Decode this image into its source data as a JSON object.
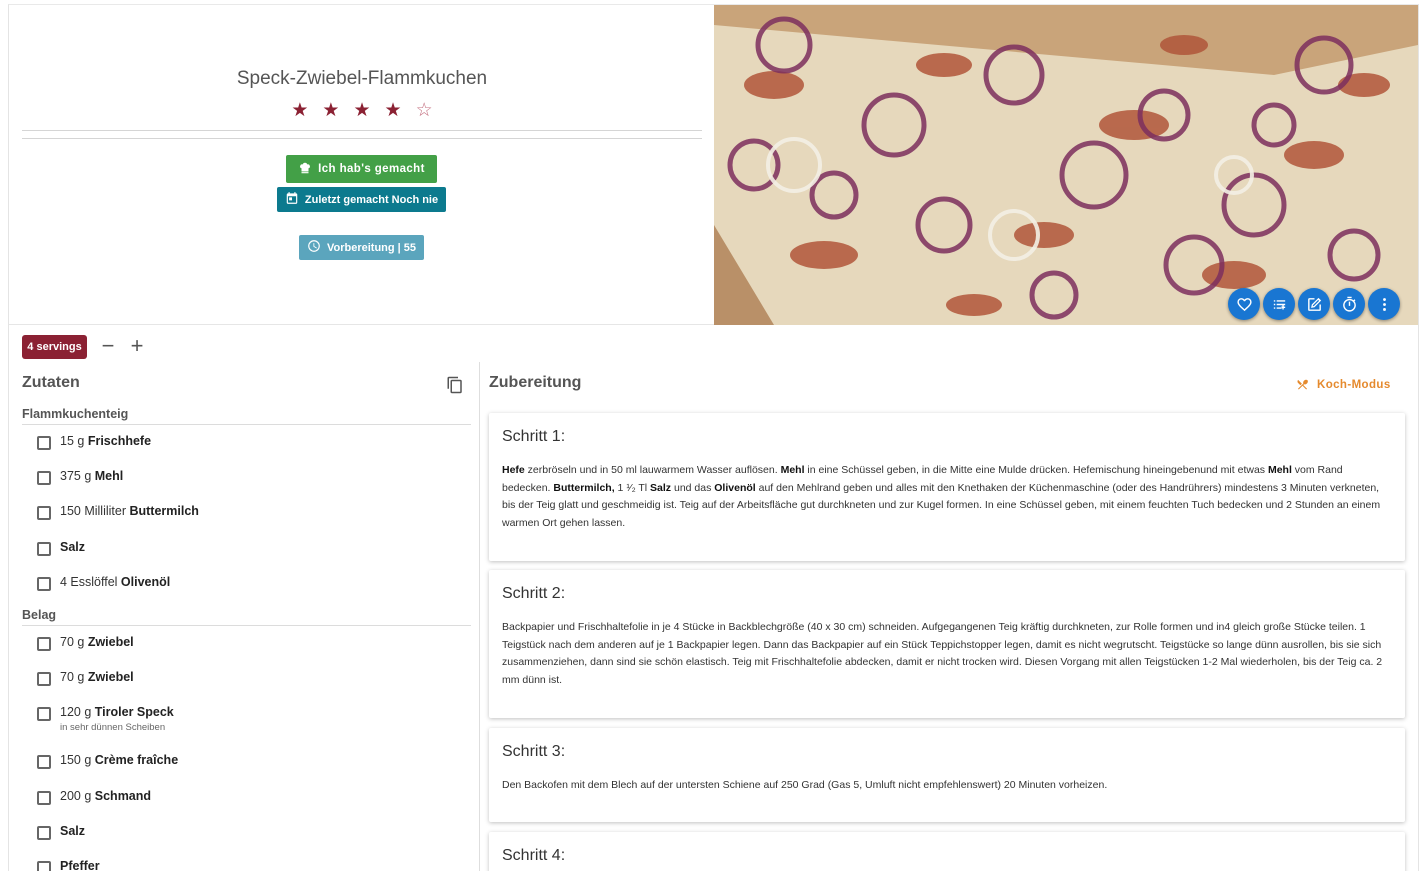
{
  "recipe": {
    "title": "Speck-Zwiebel-Flammkuchen",
    "rating": 4,
    "max_rating": 5,
    "made_button": "Ich hab's gemacht",
    "last_made": "Zuletzt gemacht Noch nie",
    "prep_time": "Vorbereitung | 55"
  },
  "servings": {
    "label": "4 servings",
    "minus": "−",
    "plus": "+"
  },
  "ingredients": {
    "title": "Zutaten",
    "groups": [
      {
        "name": "Flammkuchenteig",
        "items": [
          {
            "amount": "15 g",
            "name": "Frischhefe",
            "note": ""
          },
          {
            "amount": "375 g",
            "name": "Mehl",
            "note": ""
          },
          {
            "amount": "150 Milliliter",
            "name": "Buttermilch",
            "note": ""
          },
          {
            "amount": "",
            "name": "Salz",
            "note": ""
          },
          {
            "amount": "4 Esslöffel",
            "name": "Olivenöl",
            "note": ""
          }
        ]
      },
      {
        "name": "Belag",
        "items": [
          {
            "amount": "70 g",
            "name": "Zwiebel",
            "note": ""
          },
          {
            "amount": "70 g",
            "name": "Zwiebel",
            "note": ""
          },
          {
            "amount": "120 g",
            "name": "Tiroler Speck",
            "note": "in sehr dünnen Scheiben"
          },
          {
            "amount": "150 g",
            "name": "Crème fraîche",
            "note": ""
          },
          {
            "amount": "200 g",
            "name": "Schmand",
            "note": ""
          },
          {
            "amount": "",
            "name": "Salz",
            "note": ""
          },
          {
            "amount": "",
            "name": "Pfeffer",
            "note": ""
          }
        ]
      }
    ]
  },
  "preparation": {
    "title": "Zubereitung",
    "cook_mode": "Koch-Modus",
    "steps": [
      {
        "title": "Schritt 1:",
        "parts": [
          {
            "b": true,
            "t": "Hefe"
          },
          {
            "b": false,
            "t": " zerbröseln und in 50 ml lauwarmem Wasser auflösen. "
          },
          {
            "b": true,
            "t": "Mehl"
          },
          {
            "b": false,
            "t": " in eine Schüssel geben, in die Mitte eine Mulde drücken. Hefemischung hineingebenund mit etwas "
          },
          {
            "b": true,
            "t": "Mehl"
          },
          {
            "b": false,
            "t": " vom Rand bedecken. "
          },
          {
            "b": true,
            "t": "Buttermilch,"
          },
          {
            "b": false,
            "t": " 1 ¹⁄₂ Tl "
          },
          {
            "b": true,
            "t": "Salz"
          },
          {
            "b": false,
            "t": " und das "
          },
          {
            "b": true,
            "t": "Olivenöl"
          },
          {
            "b": false,
            "t": " auf den Mehlrand geben und alles mit den Knethaken der Küchenmaschine (oder des Handrührers) mindestens 3 Minuten verkneten, bis der Teig glatt und geschmeidig ist. Teig auf der Arbeitsfläche gut durchkneten und zur Kugel formen. In eine Schüssel geben, mit einem feuchten Tuch bedecken und 2 Stunden an einem warmen Ort gehen lassen."
          }
        ]
      },
      {
        "title": "Schritt 2:",
        "parts": [
          {
            "b": false,
            "t": "Backpapier und Frischhaltefolie in je 4 Stücke in Backblechgröße (40 x 30 cm) schneiden. Aufgegangenen Teig kräftig durchkneten, zur Rolle formen und in4 gleich große Stücke teilen. 1 Teigstück nach dem anderen auf je 1 Backpapier legen. Dann das Backpapier auf ein Stück Teppichstopper legen, damit es nicht wegrutscht. Teigstücke so lange dünn ausrollen, bis sie sich zusammenziehen, dann sind sie schön elastisch. Teig mit Frischhaltefolie abdecken, damit er nicht trocken wird. Diesen Vorgang mit allen Teigstücken 1-2 Mal wiederholen, bis der Teig ca. 2 mm dünn ist."
          }
        ]
      },
      {
        "title": "Schritt 3:",
        "parts": [
          {
            "b": false,
            "t": "Den Backofen mit dem Blech auf der untersten Schiene auf 250 Grad (Gas 5, Umluft nicht empfehlenswert) 20 Minuten vorheizen."
          }
        ]
      },
      {
        "title": "Schritt 4:",
        "parts": []
      }
    ]
  },
  "icons": {
    "made": "chef-hat-icon",
    "last_made": "calendar-icon",
    "prep": "clock-icon",
    "fabs": [
      "heart-icon",
      "list-add-icon",
      "edit-icon",
      "timer-icon",
      "more-vert-icon"
    ],
    "copy": "copy-icon",
    "cook_mode": "utensils-icon"
  },
  "colors": {
    "accent": "#8b2133",
    "success": "#43a047",
    "teal": "#0c7a8e",
    "light_teal": "#5ba5bd",
    "fab": "#1976d2",
    "orange": "#e58a2e"
  }
}
